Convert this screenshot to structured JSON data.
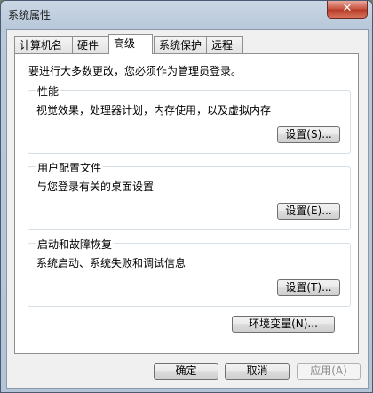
{
  "window": {
    "title": "系统属性",
    "close_label": "✕"
  },
  "tabs": [
    {
      "label": "计算机名",
      "active": false
    },
    {
      "label": "硬件",
      "active": false
    },
    {
      "label": "高级",
      "active": true
    },
    {
      "label": "系统保护",
      "active": false
    },
    {
      "label": "远程",
      "active": false
    }
  ],
  "advanced": {
    "notice": "要进行大多数更改，您必须作为管理员登录。",
    "performance": {
      "title": "性能",
      "description": "视觉效果，处理器计划，内存使用，以及虚拟内存",
      "button": "设置(S)..."
    },
    "user_profiles": {
      "title": "用户配置文件",
      "description": "与您登录有关的桌面设置",
      "button": "设置(E)..."
    },
    "startup_recovery": {
      "title": "启动和故障恢复",
      "description": "系统启动、系统失败和调试信息",
      "button": "设置(T)..."
    },
    "env_button": "环境变量(N)..."
  },
  "footer": {
    "ok": "确定",
    "cancel": "取消",
    "apply": "应用(A)"
  }
}
